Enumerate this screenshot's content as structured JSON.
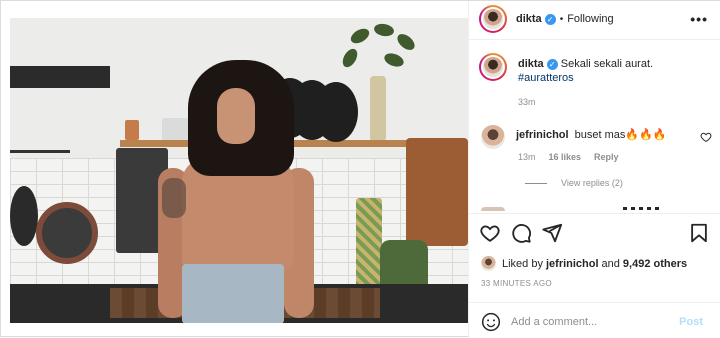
{
  "post": {
    "username": "dikta",
    "following_label": "Following",
    "more_label": "•••",
    "verified_mark": "✓"
  },
  "caption": {
    "username": "dikta",
    "text": "Sekali sekali aurat.",
    "hashtag": "#auratteros",
    "time": "33m"
  },
  "comments": [
    {
      "username": "jefrinichol",
      "text": "buset mas🔥🔥🔥",
      "time": "13m",
      "likes": "16 likes",
      "reply_label": "Reply",
      "view_replies": "View replies (2)"
    }
  ],
  "likes": {
    "prefix": "Liked by",
    "user": "jefrinichol",
    "connector": "and",
    "others": "9,492 others"
  },
  "timestamp": "33 MINUTES AGO",
  "comment_box": {
    "placeholder": "Add a comment...",
    "post_label": "Post"
  },
  "colors": {
    "accent": "#3897f0",
    "hashtag": "#00376b",
    "post_disabled": "#b2dffc",
    "muted": "#8e8e8e"
  },
  "icons": [
    "heart-icon",
    "comment-icon",
    "share-icon",
    "bookmark-icon",
    "emoji-icon",
    "more-icon",
    "verified-icon"
  ]
}
